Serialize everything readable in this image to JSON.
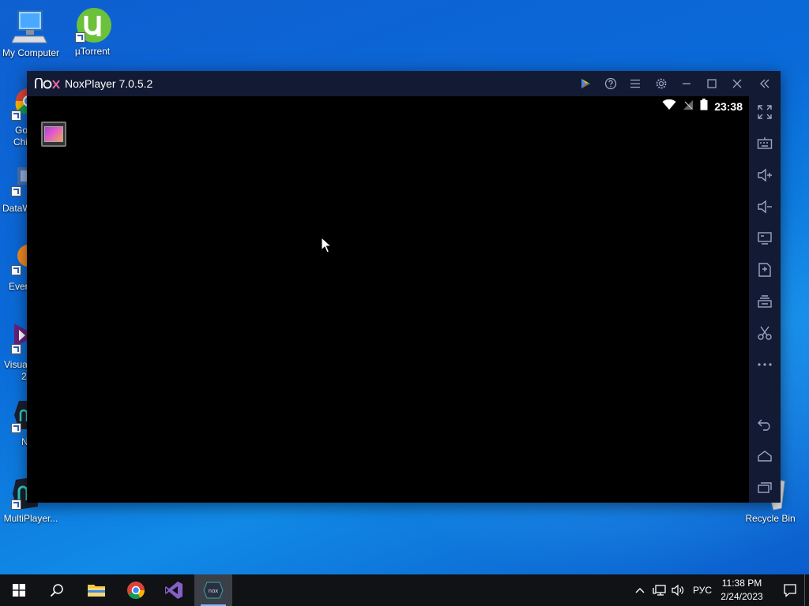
{
  "desktop": {
    "icons": [
      {
        "label": "My Computer"
      },
      {
        "label": "µTorrent"
      },
      {
        "label": "MultiPlayer..."
      },
      {
        "label": "Recycle Bin"
      }
    ],
    "partial_labels": {
      "chrome_1": "Go",
      "chrome_2": "Chi",
      "data": "DataW",
      "ever": "Ever",
      "visual_1": "Visua",
      "visual_2": "2",
      "n": "N"
    }
  },
  "nox": {
    "logo": "nox",
    "title": "NoxPlayer 7.0.5.2",
    "status_clock": "23:38",
    "titlebar_buttons": [
      "play-store-icon",
      "help-icon",
      "menu-icon",
      "settings-icon",
      "minimize-icon",
      "maximize-icon",
      "close-icon",
      "collapse-sidebar-icon"
    ],
    "sidebar_buttons": [
      "fullscreen-icon",
      "keyboard-icon",
      "volume-up-icon",
      "volume-down-icon",
      "screen-icon",
      "apk-install-icon",
      "multi-instance-icon",
      "screenshot-icon",
      "more-icon",
      "back-icon",
      "home-icon",
      "recent-apps-icon"
    ]
  },
  "taskbar": {
    "language": "РУС",
    "time": "11:38 PM",
    "date": "2/24/2023"
  },
  "colors": {
    "accent": "#7fb8ff",
    "nox_title_bg": "#131a33",
    "play_green": "#34a853"
  }
}
